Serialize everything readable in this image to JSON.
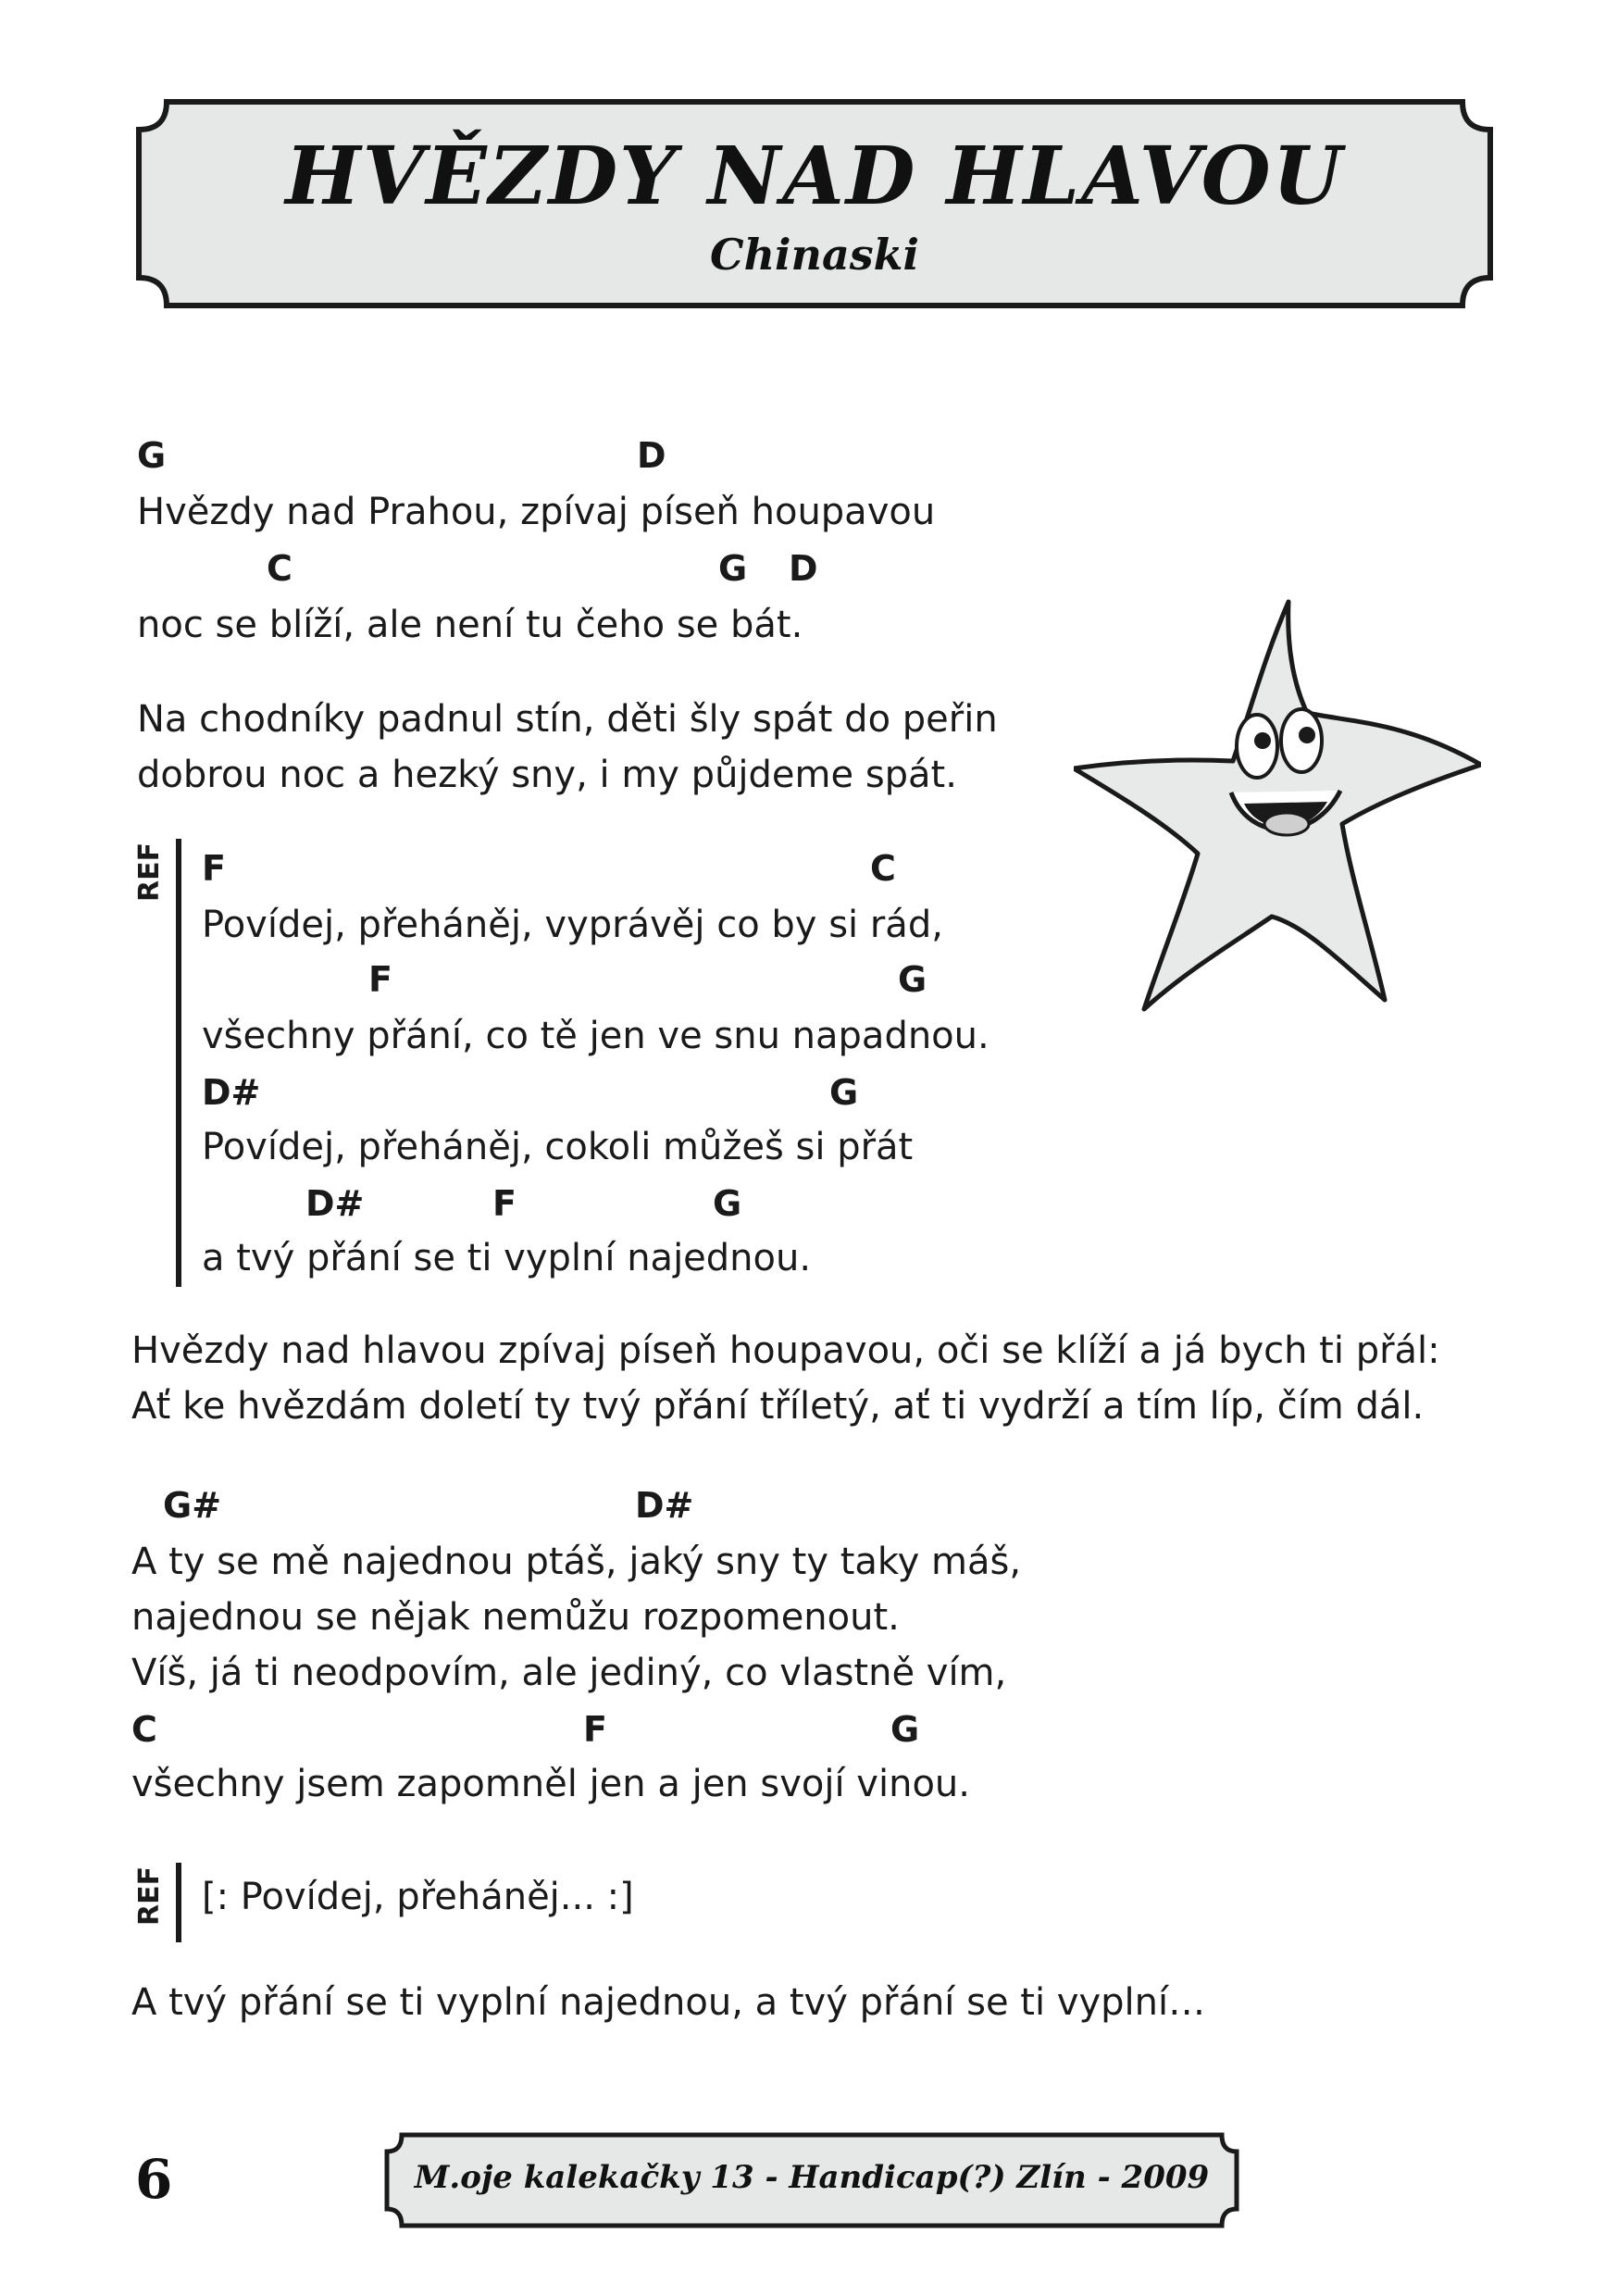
{
  "header": {
    "title": "HVĚZDY NAD HLAVOU",
    "artist": "Chinaski"
  },
  "verse1": {
    "chords1": [
      "G",
      "D"
    ],
    "line1": "Hvězdy nad Prahou, zpívaj píseň houpavou",
    "chords2": [
      "C",
      "G",
      "D"
    ],
    "line2": "noc se blíží, ale není tu čeho se bát.",
    "line3": "Na chodníky padnul stín, děti šly spát do peřin",
    "line4": "dobrou noc a hezký sny, i my půjdeme spát."
  },
  "chorus": {
    "label": "REF",
    "chords1": [
      "F",
      "C"
    ],
    "line1": "Povídej, přeháněj, vyprávěj co by si rád,",
    "chords2": [
      "F",
      "G"
    ],
    "line2": "všechny přání, co tě jen ve snu napadnou.",
    "chords3": [
      "D#",
      "G"
    ],
    "line3": "Povídej, přeháněj, cokoli můžeš si přát",
    "chords4": [
      "D#",
      "F",
      "G"
    ],
    "line4": "a tvý přání se ti vyplní najednou."
  },
  "verse2": {
    "line1": "Hvězdy nad hlavou zpívaj píseň houpavou, oči se klíží a já bych ti přál:",
    "line2": "Ať ke hvězdám doletí ty tvý přání tříletý, ať ti vydrží a tím líp, čím dál."
  },
  "bridge": {
    "chords1": [
      "G#",
      "D#"
    ],
    "line1": "A ty se mě najednou ptáš, jaký sny ty taky máš,",
    "line2": "najednou se nějak nemůžu rozpomenout.",
    "line3": "Víš, já ti neodpovím, ale jediný, co vlastně vím,",
    "chords2": [
      "C",
      "F",
      "G"
    ],
    "line4": "všechny jsem zapomněl jen a jen svojí vinou."
  },
  "chorus_repeat": {
    "label": "REF",
    "text": "[: Povídej, přeháněj... :]"
  },
  "outro": {
    "line1": "A tvý přání se ti vyplní najednou,  a tvý přání se ti vyplní…"
  },
  "footer": {
    "page_number": "6",
    "text": "M.oje kalekačky 13 - Handicap(?) Zlín - 2009"
  },
  "illustration": {
    "name": "smiling-star"
  }
}
